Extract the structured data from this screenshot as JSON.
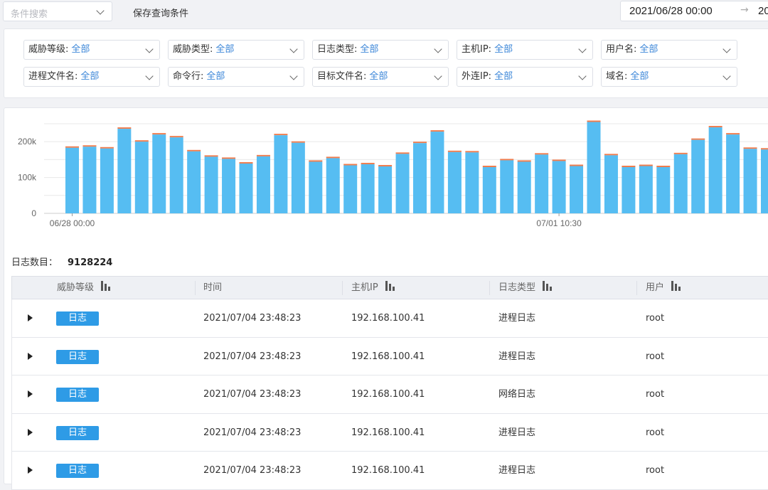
{
  "search": {
    "placeholder": "条件搜索"
  },
  "toolbar": {
    "save_query_label": "保存查询条件"
  },
  "date_range": {
    "start": "2021/06/28 00:00",
    "arrow": "→",
    "end_partial": "20"
  },
  "filters": [
    {
      "label": "威胁等级:",
      "value": "全部"
    },
    {
      "label": "威胁类型:",
      "value": "全部"
    },
    {
      "label": "日志类型:",
      "value": "全部"
    },
    {
      "label": "主机IP:",
      "value": "全部"
    },
    {
      "label": "用户名:",
      "value": "全部"
    },
    {
      "label": "进程文件名:",
      "value": "全部"
    },
    {
      "label": "命令行:",
      "value": "全部"
    },
    {
      "label": "目标文件名:",
      "value": "全部"
    },
    {
      "label": "外连IP:",
      "value": "全部"
    },
    {
      "label": "域名:",
      "value": "全部"
    }
  ],
  "colors": {
    "bar": "#56bdf2",
    "bar_top": "#f07d4e",
    "accent": "#3b86d8",
    "badge": "#2e9be6"
  },
  "chart_data": {
    "type": "bar",
    "yticks": [
      "0",
      "100k",
      "200k"
    ],
    "ylim": [
      0,
      260000
    ],
    "x_tick_labels": [
      "06/28 00:00",
      "07/01 10:30"
    ],
    "x_tick_indices": [
      0,
      28
    ],
    "grid": true,
    "series": [
      {
        "values": [
          183000,
          186000,
          181000,
          236000,
          200000,
          220000,
          212000,
          173000,
          158000,
          152000,
          139000,
          159000,
          218000,
          197000,
          144000,
          154000,
          134000,
          137000,
          131000,
          166000,
          196000,
          228000,
          171000,
          170000,
          129000,
          148000,
          144000,
          164000,
          146000,
          132000,
          255000,
          162000,
          129000,
          132000,
          129000,
          165000,
          205000,
          240000,
          220000,
          180000,
          178000
        ]
      },
      {
        "values": [
          4000,
          4000,
          4000,
          4000,
          4000,
          4000,
          4000,
          4000,
          4000,
          4000,
          4000,
          4000,
          4000,
          4000,
          4000,
          4000,
          4000,
          4000,
          4000,
          4000,
          4000,
          4000,
          4000,
          4000,
          4000,
          4000,
          4000,
          4000,
          4000,
          4000,
          4000,
          4000,
          4000,
          4000,
          4000,
          4000,
          4000,
          4000,
          4000,
          4000,
          4000
        ]
      }
    ]
  },
  "log_count": {
    "label": "日志数目：",
    "value": "9128224"
  },
  "table": {
    "columns": [
      "威胁等级",
      "时间",
      "主机IP",
      "日志类型",
      "用户"
    ],
    "rows": [
      {
        "level": "日志",
        "time": "2021/07/04  23:48:23",
        "ip": "192.168.100.41",
        "type": "进程日志",
        "user": "root"
      },
      {
        "level": "日志",
        "time": "2021/07/04  23:48:23",
        "ip": "192.168.100.41",
        "type": "进程日志",
        "user": "root"
      },
      {
        "level": "日志",
        "time": "2021/07/04  23:48:23",
        "ip": "192.168.100.41",
        "type": "网络日志",
        "user": "root"
      },
      {
        "level": "日志",
        "time": "2021/07/04  23:48:23",
        "ip": "192.168.100.41",
        "type": "进程日志",
        "user": "root"
      },
      {
        "level": "日志",
        "time": "2021/07/04  23:48:23",
        "ip": "192.168.100.41",
        "type": "进程日志",
        "user": "root"
      }
    ]
  }
}
